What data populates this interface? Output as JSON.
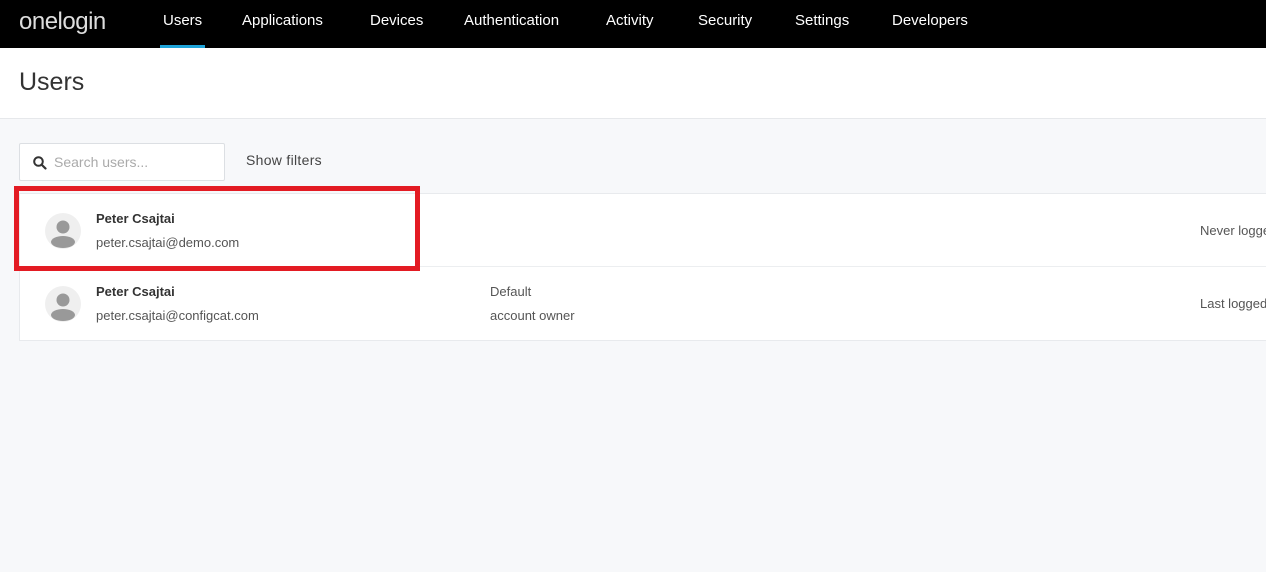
{
  "nav": {
    "logo": "onelogin",
    "items": [
      {
        "label": "Users",
        "active": true
      },
      {
        "label": "Applications"
      },
      {
        "label": "Devices"
      },
      {
        "label": "Authentication"
      },
      {
        "label": "Activity"
      },
      {
        "label": "Security"
      },
      {
        "label": "Settings"
      },
      {
        "label": "Developers"
      }
    ],
    "accent": "#1ea4d9"
  },
  "header": {
    "title": "Users"
  },
  "search": {
    "placeholder": "Search users...",
    "value": "",
    "icon": "search-icon"
  },
  "filters_label": "Show filters",
  "users": [
    {
      "name": "Peter Csajtai",
      "email": "peter.csajtai@demo.com",
      "role_line1": "",
      "role_line2": "",
      "login": "Never logge",
      "highlighted": true
    },
    {
      "name": "Peter Csajtai",
      "email": "peter.csajtai@configcat.com",
      "role_line1": "Default",
      "role_line2": "account owner",
      "login": "Last logged"
    }
  ],
  "highlight_color": "#e31b23"
}
